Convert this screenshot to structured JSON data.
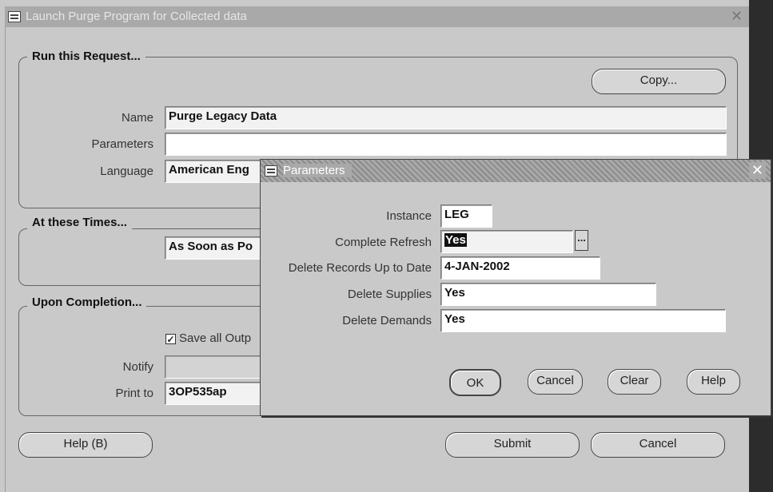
{
  "window": {
    "title": "Launch Purge Program for Collected data",
    "close_glyph": "✕"
  },
  "run_request": {
    "group_title": "Run this Request...",
    "copy_label": "Copy...",
    "name_label": "Name",
    "name_value": "Purge Legacy Data",
    "parameters_label": "Parameters",
    "parameters_value": "",
    "language_label": "Language",
    "language_value": "American Eng"
  },
  "times": {
    "group_title": "At these Times...",
    "value": "As Soon as Po"
  },
  "completion": {
    "group_title": "Upon Completion...",
    "save_output_label": "Save all Outp",
    "save_output_checked": true,
    "notify_label": "Notify",
    "notify_value": "",
    "print_to_label": "Print to",
    "print_to_value": "3OP535ap"
  },
  "footer": {
    "help_label": "Help (B)",
    "submit_label": "Submit",
    "cancel_label": "Cancel"
  },
  "dialog": {
    "title": "Parameters",
    "close_glyph": "✕",
    "instance_label": "Instance",
    "instance_value": "LEG",
    "complete_refresh_label": "Complete Refresh",
    "complete_refresh_value": "Yes",
    "lov_glyph": "...",
    "delete_upto_label": "Delete Records Up to Date",
    "delete_upto_value": "4-JAN-2002",
    "delete_supplies_label": "Delete Supplies",
    "delete_supplies_value": "Yes",
    "delete_demands_label": "Delete Demands",
    "delete_demands_value": "Yes",
    "ok_label": "OK",
    "cancel_label": "Cancel",
    "clear_label": "Clear",
    "help_label": "Help"
  }
}
